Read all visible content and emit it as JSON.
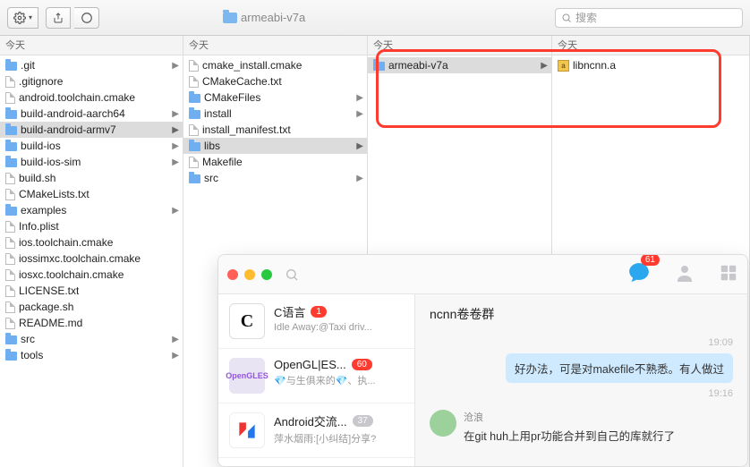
{
  "toolbar": {
    "path_label": "armeabi-v7a",
    "search_placeholder": "搜索"
  },
  "columns": {
    "header": "今天",
    "col1": [
      {
        "name": ".git",
        "type": "folder",
        "expand": true
      },
      {
        "name": ".gitignore",
        "type": "file"
      },
      {
        "name": "android.toolchain.cmake",
        "type": "file"
      },
      {
        "name": "build-android-aarch64",
        "type": "folder",
        "expand": true
      },
      {
        "name": "build-android-armv7",
        "type": "folder",
        "expand": true,
        "selected": true
      },
      {
        "name": "build-ios",
        "type": "folder",
        "expand": true
      },
      {
        "name": "build-ios-sim",
        "type": "folder",
        "expand": true
      },
      {
        "name": "build.sh",
        "type": "file"
      },
      {
        "name": "CMakeLists.txt",
        "type": "file"
      },
      {
        "name": "examples",
        "type": "folder",
        "expand": true
      },
      {
        "name": "Info.plist",
        "type": "file"
      },
      {
        "name": "ios.toolchain.cmake",
        "type": "file"
      },
      {
        "name": "iossimxc.toolchain.cmake",
        "type": "file"
      },
      {
        "name": "iosxc.toolchain.cmake",
        "type": "file"
      },
      {
        "name": "LICENSE.txt",
        "type": "file"
      },
      {
        "name": "package.sh",
        "type": "file"
      },
      {
        "name": "README.md",
        "type": "file"
      },
      {
        "name": "src",
        "type": "folder",
        "expand": true
      },
      {
        "name": "tools",
        "type": "folder",
        "expand": true
      }
    ],
    "col2": [
      {
        "name": "cmake_install.cmake",
        "type": "file"
      },
      {
        "name": "CMakeCache.txt",
        "type": "file"
      },
      {
        "name": "CMakeFiles",
        "type": "folder",
        "expand": true
      },
      {
        "name": "install",
        "type": "folder",
        "expand": true
      },
      {
        "name": "install_manifest.txt",
        "type": "file"
      },
      {
        "name": "libs",
        "type": "folder",
        "expand": true,
        "selected": true
      },
      {
        "name": "Makefile",
        "type": "file"
      },
      {
        "name": "src",
        "type": "folder",
        "expand": true
      }
    ],
    "col3": [
      {
        "name": "armeabi-v7a",
        "type": "folder",
        "expand": true,
        "selected": true
      }
    ],
    "col4": [
      {
        "name": "libncnn.a",
        "type": "archive"
      }
    ]
  },
  "chat": {
    "badge": "61",
    "room_title": "ncnn卷卷群",
    "conversations": [
      {
        "title": "C语言",
        "sub": "Idle Away:@Taxi driv...",
        "badge": "1",
        "badge_style": "red",
        "avatar": "C"
      },
      {
        "title": "OpenGL|ES...",
        "sub": "💎与生俱来的💎、执...",
        "badge": "60",
        "badge_style": "red",
        "avatar": "GLES"
      },
      {
        "title": "Android交流...",
        "sub": "萍水烟雨:[小纠结]分享?",
        "badge": "37",
        "badge_style": "grey",
        "avatar": "A"
      }
    ],
    "timeline": {
      "ts1": "19:09",
      "out1": "好办法，可是对makefile不熟悉。有人做过",
      "ts2": "19:16",
      "in_user": "沧浪",
      "in_text": "在git huh上用pr功能合并到自己的库就行了"
    }
  }
}
